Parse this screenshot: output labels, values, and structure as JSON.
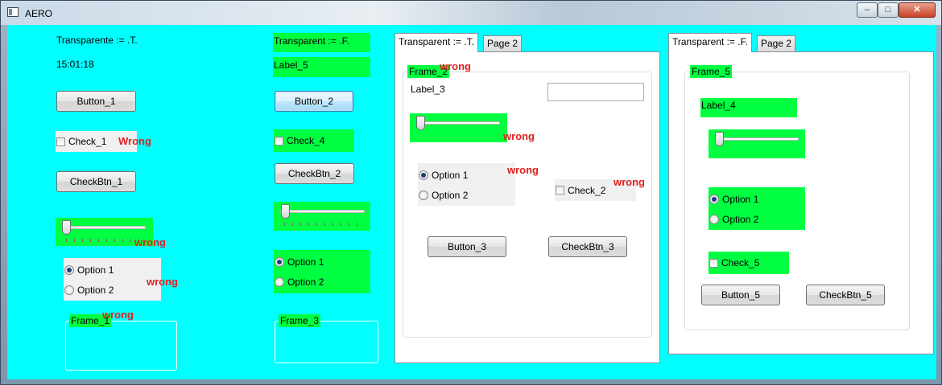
{
  "window": {
    "title": "AERO",
    "controls": {
      "minimize": "–",
      "maximize": "□",
      "close": "✕"
    }
  },
  "col1": {
    "label_transparent": "Transparente := .T.",
    "label_time": "15:01:18",
    "button": "Button_1",
    "check": "Check_1",
    "check_wrong": "Wrong",
    "checkbtn": "CheckBtn_1",
    "slider_wrong": "wrong",
    "option1": "Option 1",
    "option2": "Option 2",
    "radio_wrong": "wrong",
    "frame": "Frame_1",
    "frame_wrong": "wrong"
  },
  "col2": {
    "label_transparent": "Transparent := .F.",
    "label5": "Label_5",
    "button": "Button_2",
    "check": "Check_4",
    "checkbtn": "CheckBtn_2",
    "option1": "Option 1",
    "option2": "Option 2",
    "frame": "Frame_3"
  },
  "tab1": {
    "tab_active": "Transparent := .T.",
    "tab2": "Page 2",
    "frame": "Frame_2",
    "frame_wrong": "wrong",
    "label3": "Label_3",
    "slider_wrong": "wrong",
    "option1": "Option 1",
    "option2": "Option 2",
    "radio_wrong": "wrong",
    "check": "Check_2",
    "check_wrong": "wrong",
    "button": "Button_3",
    "checkbtn": "CheckBtn_3"
  },
  "tab2": {
    "tab_active": "Transparent := .F.",
    "tab2": "Page 2",
    "frame": "Frame_5",
    "label4": "Label_4",
    "option1": "Option 1",
    "option2": "Option 2",
    "check": "Check_5",
    "button": "Button_5",
    "checkbtn": "CheckBtn_5"
  },
  "colors": {
    "client_bg": "#00ffff",
    "green": "#00ff40",
    "wrong": "#e02020"
  }
}
